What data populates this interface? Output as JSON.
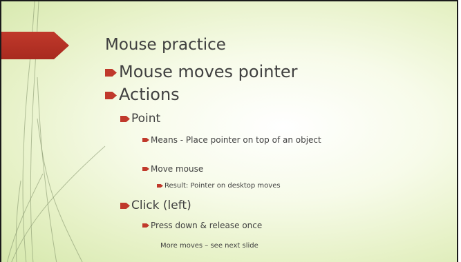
{
  "slide": {
    "title": "Mouse practice",
    "items": [
      {
        "text": "Mouse moves pointer"
      },
      {
        "text": "Actions"
      },
      {
        "text": "Point"
      },
      {
        "text": "Means - Place pointer on top of an object"
      },
      {
        "text": "Move mouse"
      },
      {
        "text": "Result: Pointer on desktop moves"
      },
      {
        "text": "Click (left)"
      },
      {
        "text": "Press down & release once"
      }
    ],
    "footer_note": "More moves – see next slide"
  },
  "colors": {
    "accent": "#c0392b",
    "text": "#404040",
    "background": "#e6f1c6"
  }
}
